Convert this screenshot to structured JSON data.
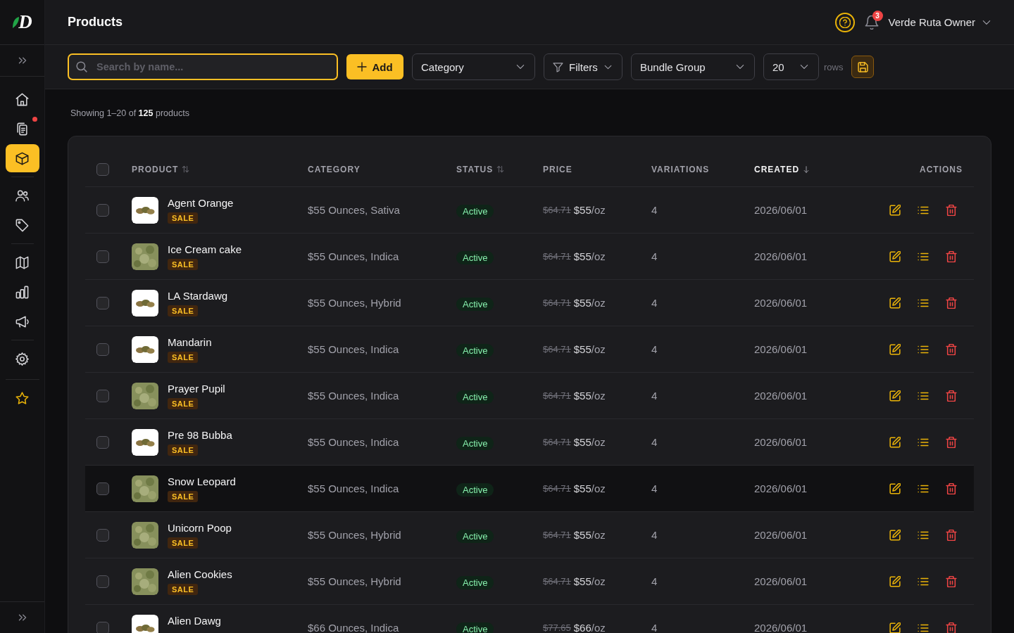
{
  "sidebar": {
    "logo": "D",
    "groups": [
      {
        "items": [
          {
            "selected": false,
            "alert": false
          },
          {
            "selected": false,
            "alert": true
          },
          {
            "selected": true,
            "alert": false
          }
        ]
      },
      {
        "items": [
          {
            "selected": false,
            "alert": false
          },
          {
            "selected": false,
            "alert": false
          }
        ]
      },
      {
        "items": [
          {
            "selected": false,
            "alert": false
          },
          {
            "selected": false,
            "alert": false
          },
          {
            "selected": false,
            "alert": false
          }
        ]
      },
      {
        "items": [
          {
            "selected": false,
            "alert": false
          }
        ]
      },
      {
        "items": [
          {
            "selected": false,
            "alert": false
          }
        ]
      }
    ]
  },
  "header": {
    "title": "Products",
    "notifications": {
      "count": "3"
    },
    "user": {
      "name": "Verde Ruta Owner"
    }
  },
  "toolbar": {
    "search": {
      "placeholder": "Search by name...",
      "focused": true
    },
    "add_button": "Add",
    "category_select": "Category",
    "filters_button": "Filters",
    "bundle_select": "Bundle Group",
    "rows_select": {
      "value": "20",
      "label": "rows"
    }
  },
  "summary": "Showing 1–20 of **125** products",
  "table": {
    "select_all": {
      "checked": false
    },
    "columns": [
      {
        "label": "PRODUCT",
        "sortable": true,
        "sorted": false
      },
      {
        "label": "CATEGORY",
        "sortable": false,
        "sorted": false
      },
      {
        "label": "STATUS",
        "sortable": true,
        "sorted": false
      },
      {
        "label": "PRICE",
        "sortable": false,
        "sorted": false
      },
      {
        "label": "VARIATIONS",
        "sortable": false,
        "sorted": false
      },
      {
        "label": "CREATED",
        "sortable": true,
        "sorted": true
      },
      {
        "label": "ACTIONS",
        "sortable": false,
        "sorted": false
      }
    ],
    "rows": [
      {
        "name": "Agent Orange",
        "badge": "SALE",
        "photo": {
          "kind": "cutout"
        },
        "category": "$55 Ounces, Sativa",
        "status": "Active",
        "old_price": "$64.71",
        "price": "$55",
        "unit": "/oz",
        "variations": "4",
        "created": "2026/06/01",
        "selected": false,
        "hovered": false
      },
      {
        "name": "Ice Cream cake",
        "badge": "SALE",
        "photo": {
          "kind": "closeup"
        },
        "category": "$55 Ounces, Indica",
        "status": "Active",
        "old_price": "$64.71",
        "price": "$55",
        "unit": "/oz",
        "variations": "4",
        "created": "2026/06/01",
        "selected": false,
        "hovered": false
      },
      {
        "name": "LA Stardawg",
        "badge": "SALE",
        "photo": {
          "kind": "cutout"
        },
        "category": "$55 Ounces, Hybrid",
        "status": "Active",
        "old_price": "$64.71",
        "price": "$55",
        "unit": "/oz",
        "variations": "4",
        "created": "2026/06/01",
        "selected": false,
        "hovered": false
      },
      {
        "name": "Mandarin",
        "badge": "SALE",
        "photo": {
          "kind": "cutout"
        },
        "category": "$55 Ounces, Indica",
        "status": "Active",
        "old_price": "$64.71",
        "price": "$55",
        "unit": "/oz",
        "variations": "4",
        "created": "2026/06/01",
        "selected": false,
        "hovered": false
      },
      {
        "name": "Prayer Pupil",
        "badge": "SALE",
        "photo": {
          "kind": "closeup"
        },
        "category": "$55 Ounces, Indica",
        "status": "Active",
        "old_price": "$64.71",
        "price": "$55",
        "unit": "/oz",
        "variations": "4",
        "created": "2026/06/01",
        "selected": false,
        "hovered": false
      },
      {
        "name": "Pre 98 Bubba",
        "badge": "SALE",
        "photo": {
          "kind": "cutout"
        },
        "category": "$55 Ounces, Indica",
        "status": "Active",
        "old_price": "$64.71",
        "price": "$55",
        "unit": "/oz",
        "variations": "4",
        "created": "2026/06/01",
        "selected": false,
        "hovered": false
      },
      {
        "name": "Snow Leopard",
        "badge": "SALE",
        "photo": {
          "kind": "closeup"
        },
        "category": "$55 Ounces, Indica",
        "status": "Active",
        "old_price": "$64.71",
        "price": "$55",
        "unit": "/oz",
        "variations": "4",
        "created": "2026/06/01",
        "selected": false,
        "hovered": true
      },
      {
        "name": "Unicorn Poop",
        "badge": "SALE",
        "photo": {
          "kind": "closeup"
        },
        "category": "$55 Ounces, Hybrid",
        "status": "Active",
        "old_price": "$64.71",
        "price": "$55",
        "unit": "/oz",
        "variations": "4",
        "created": "2026/06/01",
        "selected": false,
        "hovered": false
      },
      {
        "name": "Alien Cookies",
        "badge": "SALE",
        "photo": {
          "kind": "closeup"
        },
        "category": "$55 Ounces, Hybrid",
        "status": "Active",
        "old_price": "$64.71",
        "price": "$55",
        "unit": "/oz",
        "variations": "4",
        "created": "2026/06/01",
        "selected": false,
        "hovered": false
      },
      {
        "name": "Alien Dawg",
        "photo": {
          "kind": "cutout"
        },
        "category": "$66 Ounces, Indica",
        "status": "Active",
        "old_price": "$77.65",
        "price": "$66",
        "unit": "/oz",
        "variations": "4",
        "created": "2026/06/01",
        "selected": false,
        "hovered": false
      }
    ]
  }
}
